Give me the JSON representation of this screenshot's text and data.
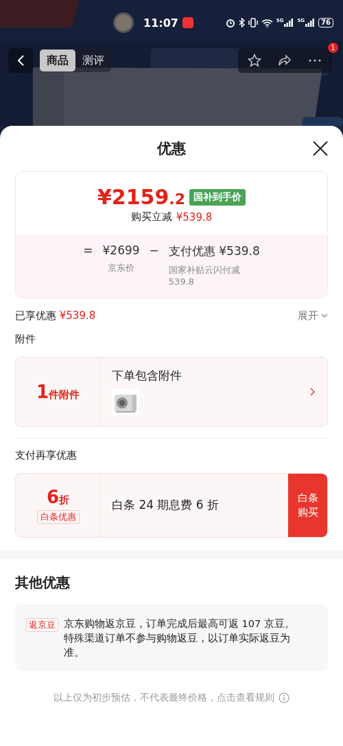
{
  "status_bar": {
    "time": "11:07",
    "network": [
      "5G",
      "5G"
    ],
    "battery": "76"
  },
  "nav": {
    "tabs": [
      {
        "label": "商品",
        "selected": true
      },
      {
        "label": "测评",
        "selected": false
      }
    ],
    "notification_badge": "1"
  },
  "sheet": {
    "title": "优惠"
  },
  "price_card": {
    "currency": "¥",
    "price_integer": "2159",
    "price_decimal": ".2",
    "badge": "国补到手价",
    "reduction_label": "购买立减",
    "reduction_amount": "¥539.8",
    "equals": "=",
    "base_price": "¥2699",
    "base_label": "京东价",
    "minus": "−",
    "discount": "支付优惠 ¥539.8",
    "discount_note": "国家补贴云闪付减539.8"
  },
  "enjoyed": {
    "label": "已享优惠",
    "amount": "¥539.8",
    "toggle": "展开"
  },
  "accessories": {
    "heading": "附件",
    "count": "1",
    "count_unit": "件附件",
    "title": "下单包含附件"
  },
  "pay_offer": {
    "heading": "支付再享优惠",
    "discount": "6",
    "discount_unit": "折",
    "tag": "白条优惠",
    "description": "白条 24 期息费 6 折",
    "button": "白条购买"
  },
  "other_offers": {
    "heading": "其他优惠",
    "items": [
      {
        "tag": "返京豆",
        "text": "京东购物返京豆，订单完成后最高可返 107 京豆。特殊渠道订单不参与购物返豆，以订单实际返豆为准。"
      }
    ]
  },
  "footer_note": "以上仅为初步预估，不代表最终价格，点击查看规则"
}
